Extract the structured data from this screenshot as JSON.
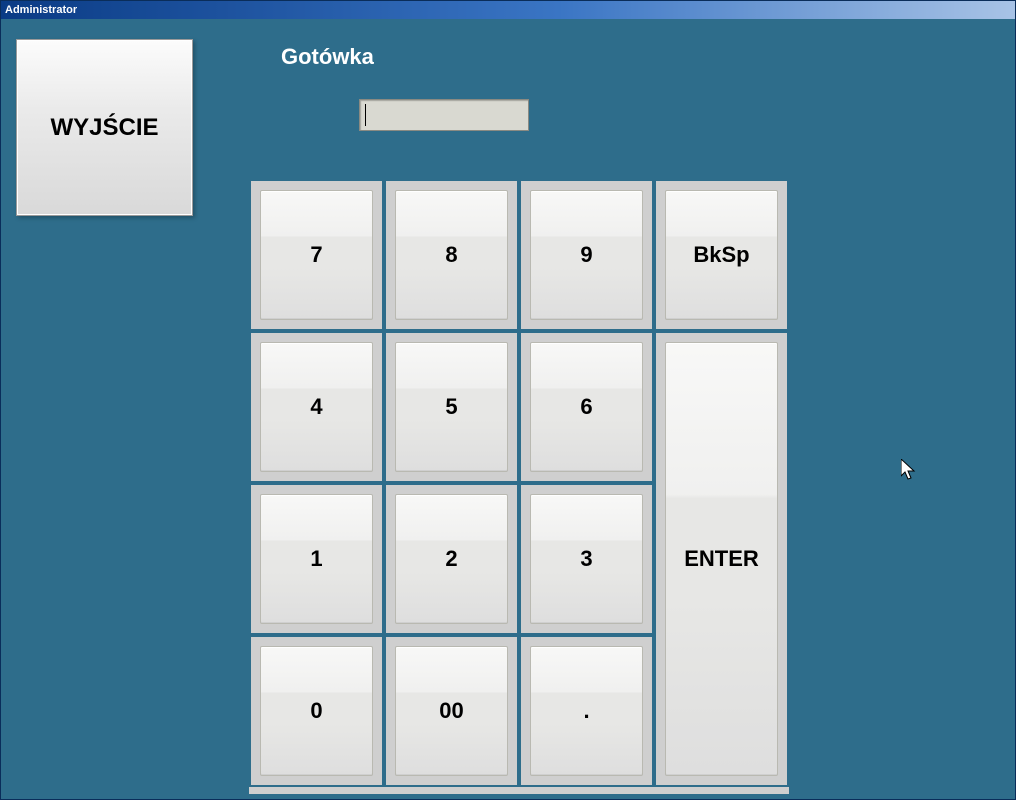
{
  "window": {
    "title": "Administrator"
  },
  "exit": {
    "label": "WYJŚCIE"
  },
  "heading": "Gotówka",
  "amount": {
    "value": ""
  },
  "keypad": {
    "k7": "7",
    "k8": "8",
    "k9": "9",
    "bksp": "BkSp",
    "k4": "4",
    "k5": "5",
    "k6": "6",
    "k1": "1",
    "k2": "2",
    "k3": "3",
    "k0": "0",
    "k00": "00",
    "kdot": ".",
    "enter": "ENTER"
  }
}
